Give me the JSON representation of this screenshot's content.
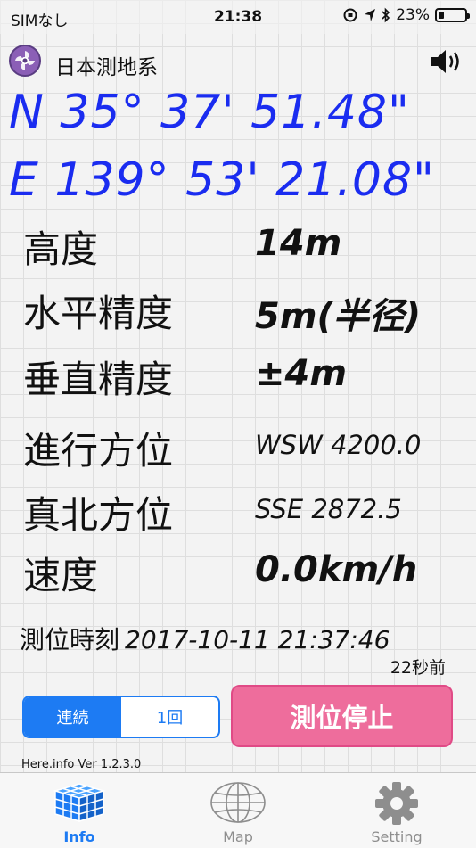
{
  "status": {
    "carrier": "SIMなし",
    "time": "21:38",
    "battery": "23%",
    "battery_level": 0.23
  },
  "header": {
    "datum": "日本測地系"
  },
  "coords": {
    "north": "N  35° 37' 51.48\"",
    "east": "E 139° 53' 21.08\""
  },
  "rows": [
    {
      "label": "高度",
      "value": "14m"
    },
    {
      "label": "水平精度",
      "value": "5m(半径)"
    },
    {
      "label": "垂直精度",
      "value": "±4m"
    },
    {
      "label": "進行方位",
      "value": "WSW 4200.0"
    },
    {
      "label": "真北方位",
      "value": "SSE 2872.5"
    },
    {
      "label": "速度",
      "value": "0.0km/h"
    }
  ],
  "fix": {
    "label": "測位時刻",
    "timestamp": "2017-10-11  21:37:46",
    "ago": "22秒前"
  },
  "mode": {
    "continuous": "連続",
    "once": "1回"
  },
  "stop_button": "測位停止",
  "version": "Here.info Ver 1.2.3.0",
  "tabs": [
    {
      "label": "Info",
      "icon": "cube-grid-icon"
    },
    {
      "label": "Map",
      "icon": "globe-icon"
    },
    {
      "label": "Setting",
      "icon": "gear-icon"
    }
  ],
  "colors": {
    "coord": "#1a2cf0",
    "accent": "#1d7bf3",
    "stop": "#ee6d9c"
  }
}
